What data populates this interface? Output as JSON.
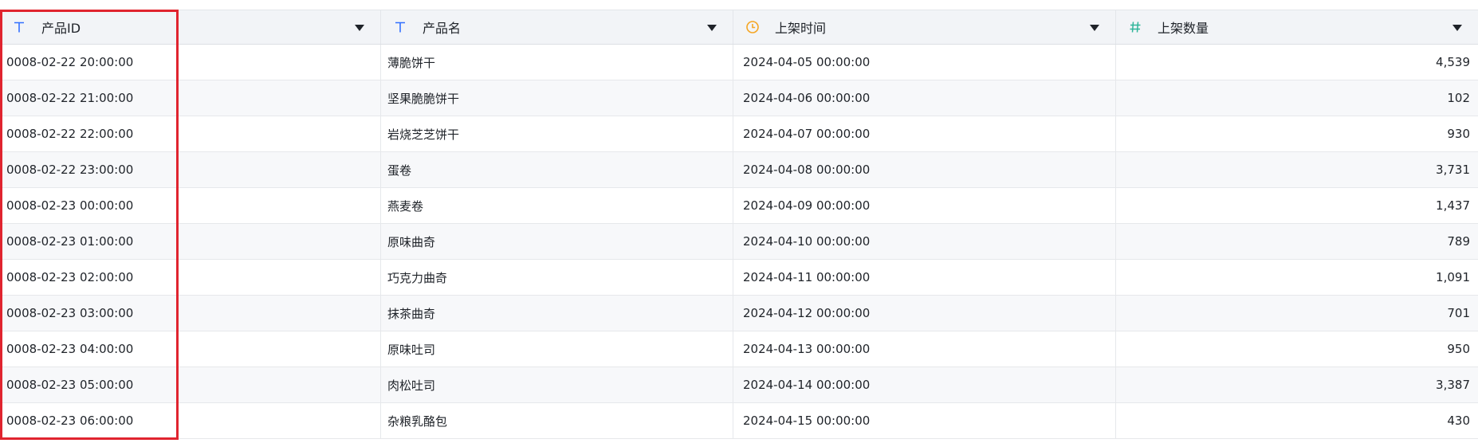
{
  "columns": [
    {
      "label": "产品ID",
      "icon": "text-type-icon"
    },
    {
      "label": "产品名",
      "icon": "text-type-icon"
    },
    {
      "label": "上架时间",
      "icon": "clock-icon"
    },
    {
      "label": "上架数量",
      "icon": "number-hash-icon"
    }
  ],
  "rows": [
    {
      "id": "0008-02-22 20:00:00",
      "name": "薄脆饼干",
      "time": "2024-04-05 00:00:00",
      "qty": "4,539"
    },
    {
      "id": "0008-02-22 21:00:00",
      "name": "坚果脆脆饼干",
      "time": "2024-04-06 00:00:00",
      "qty": "102"
    },
    {
      "id": "0008-02-22 22:00:00",
      "name": "岩烧芝芝饼干",
      "time": "2024-04-07 00:00:00",
      "qty": "930"
    },
    {
      "id": "0008-02-22 23:00:00",
      "name": "蛋卷",
      "time": "2024-04-08 00:00:00",
      "qty": "3,731"
    },
    {
      "id": "0008-02-23 00:00:00",
      "name": "燕麦卷",
      "time": "2024-04-09 00:00:00",
      "qty": "1,437"
    },
    {
      "id": "0008-02-23 01:00:00",
      "name": "原味曲奇",
      "time": "2024-04-10 00:00:00",
      "qty": "789"
    },
    {
      "id": "0008-02-23 02:00:00",
      "name": "巧克力曲奇",
      "time": "2024-04-11 00:00:00",
      "qty": "1,091"
    },
    {
      "id": "0008-02-23 03:00:00",
      "name": "抹茶曲奇",
      "time": "2024-04-12 00:00:00",
      "qty": "701"
    },
    {
      "id": "0008-02-23 04:00:00",
      "name": "原味吐司",
      "time": "2024-04-13 00:00:00",
      "qty": "950"
    },
    {
      "id": "0008-02-23 05:00:00",
      "name": "肉松吐司",
      "time": "2024-04-14 00:00:00",
      "qty": "3,387"
    },
    {
      "id": "0008-02-23 06:00:00",
      "name": "杂粮乳酪包",
      "time": "2024-04-15 00:00:00",
      "qty": "430"
    }
  ],
  "colors": {
    "text_icon": "#3370ff",
    "clock_icon": "#f5a623",
    "hash_icon": "#2fb59a",
    "highlight_border": "#e0242f"
  }
}
